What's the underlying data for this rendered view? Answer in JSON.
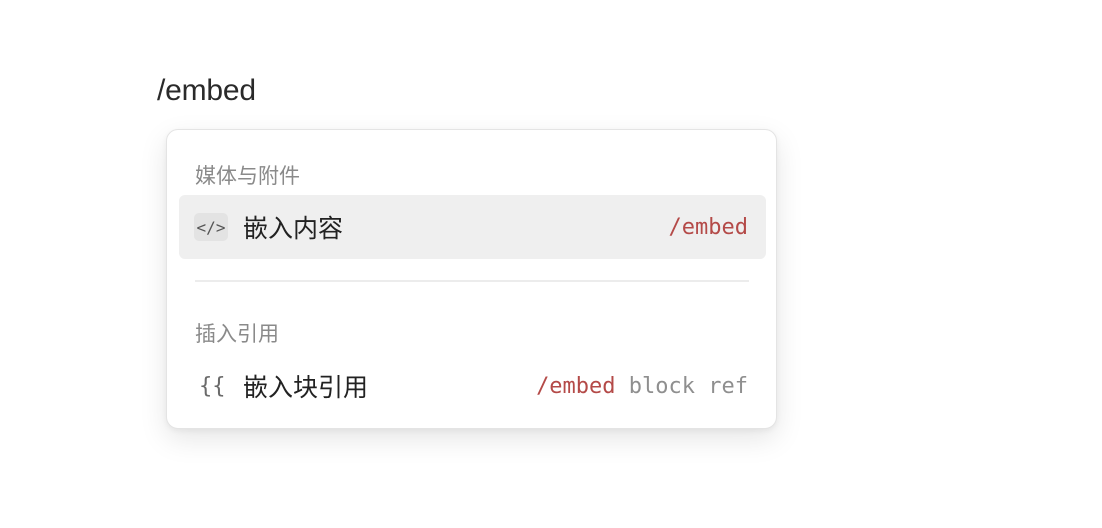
{
  "editor": {
    "typed_text": "/embed"
  },
  "menu": {
    "sections": [
      {
        "title": "媒体与附件",
        "items": [
          {
            "icon": "code-icon",
            "icon_glyph": "</>",
            "label": "嵌入内容",
            "shortcut_cmd": "/embed",
            "shortcut_rest": "",
            "active": true
          }
        ]
      },
      {
        "title": "插入引用",
        "items": [
          {
            "icon": "braces-icon",
            "icon_glyph": "{{",
            "label": "嵌入块引用",
            "shortcut_cmd": "/embed",
            "shortcut_rest": " block ref",
            "active": false
          }
        ]
      }
    ]
  },
  "colors": {
    "shortcut_accent": "#b44a48",
    "active_row_bg": "#efefef"
  }
}
